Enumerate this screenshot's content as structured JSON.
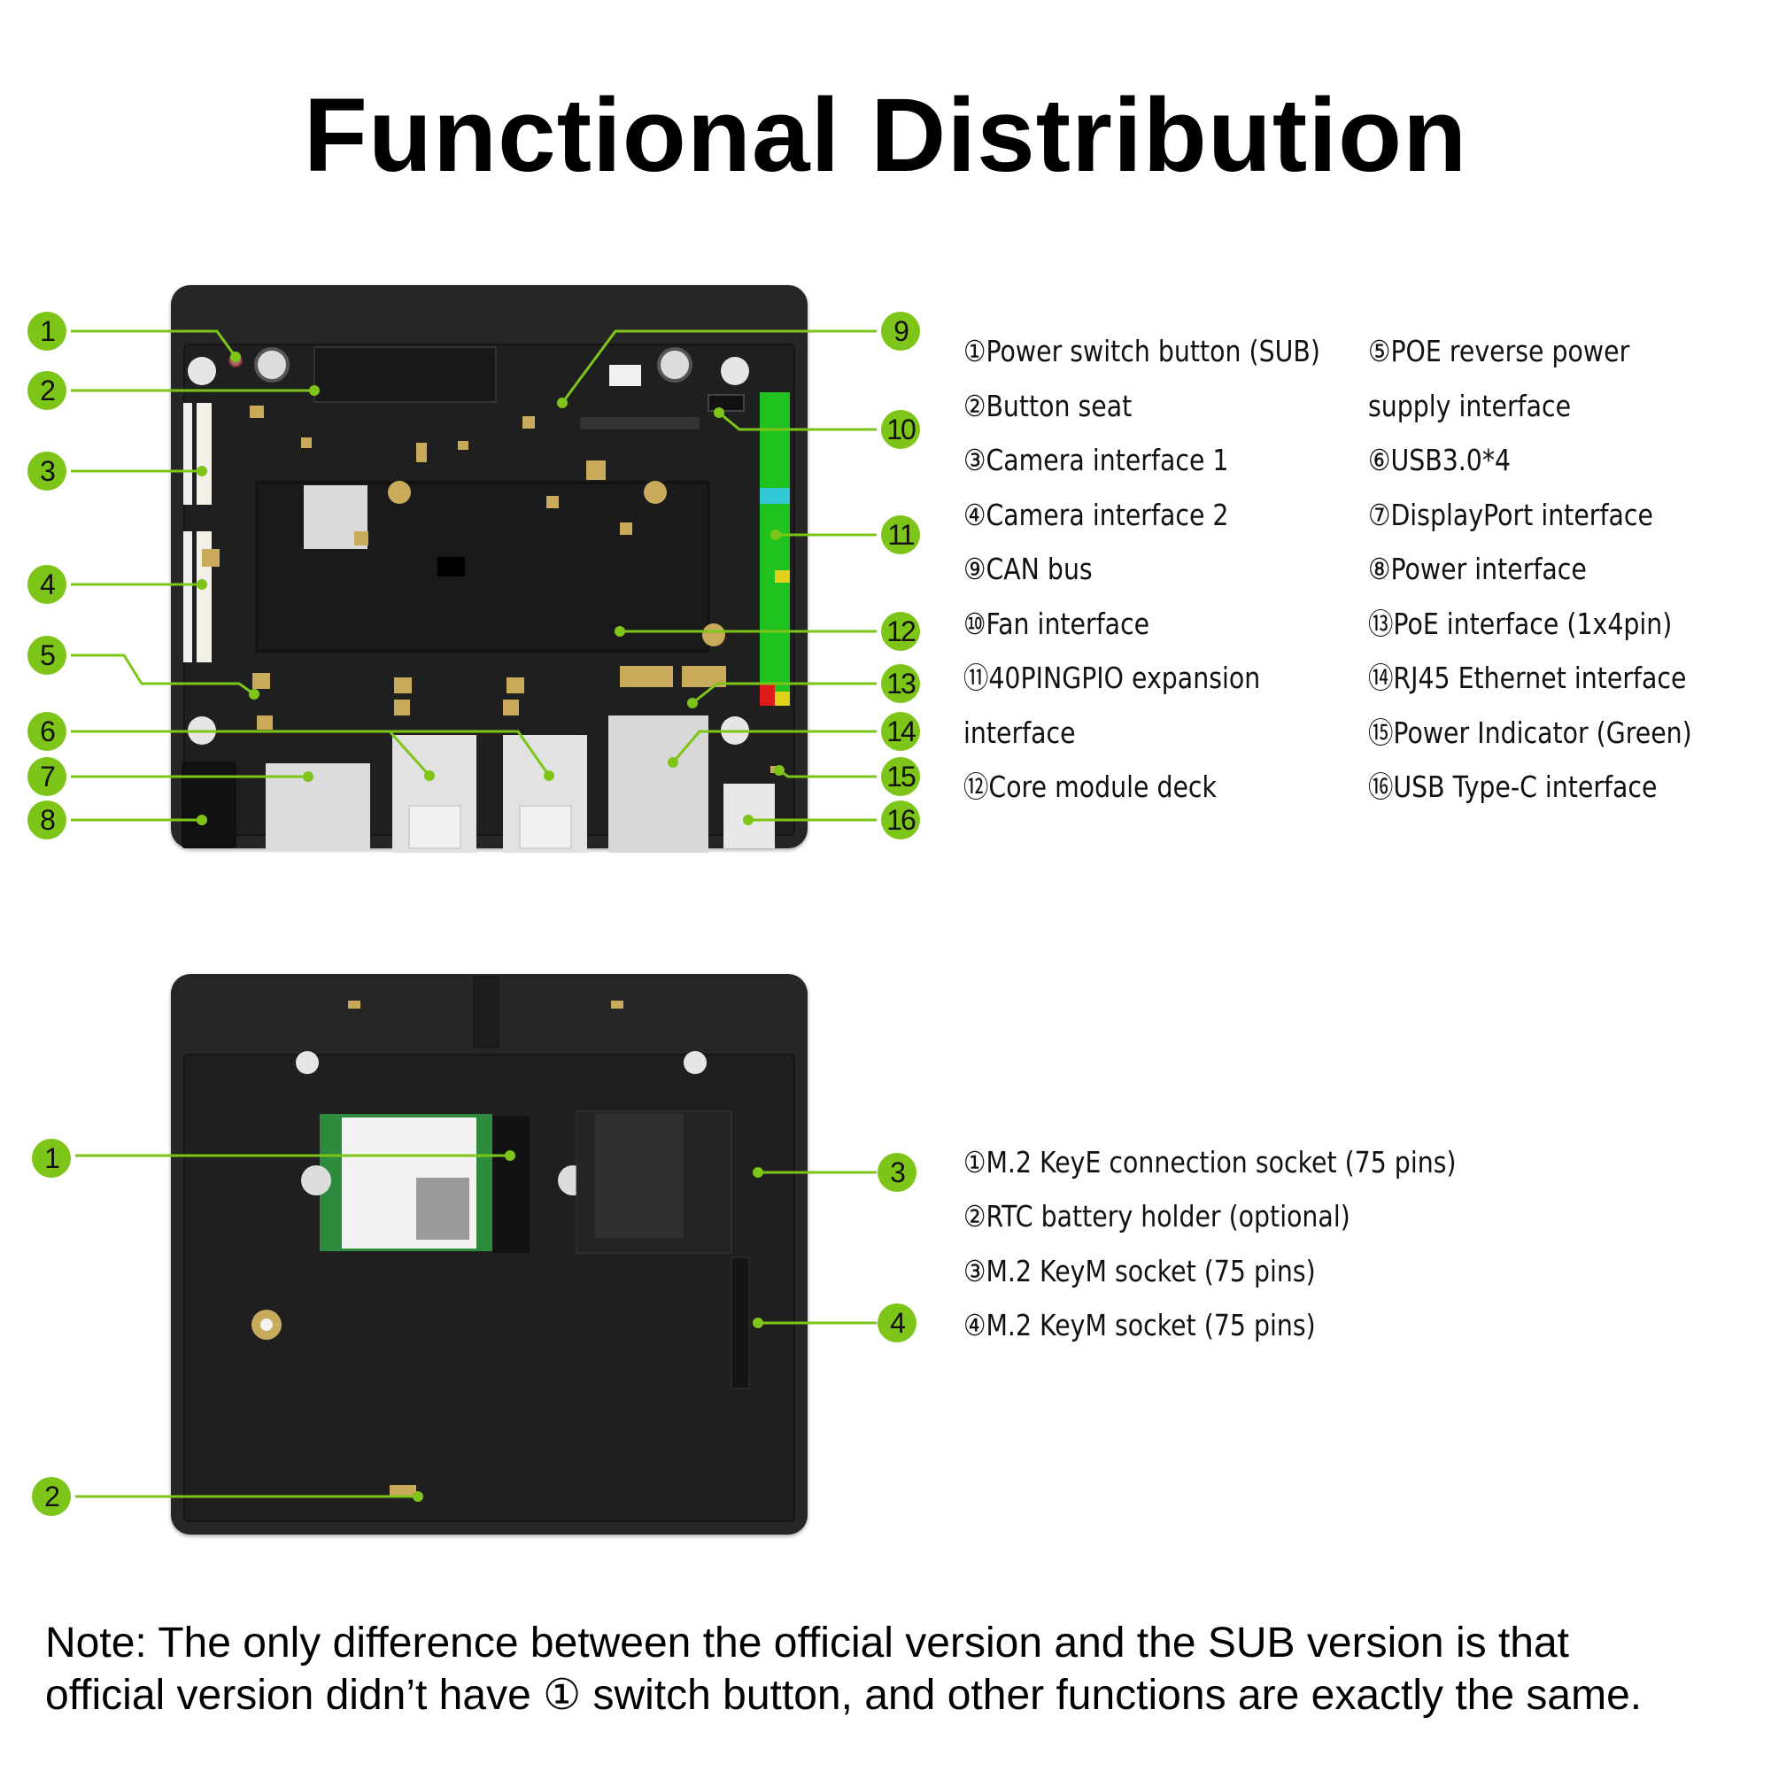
{
  "title": "Functional Distribution",
  "colors": {
    "callout_green": "#7ec51a",
    "board_dark": "#262626",
    "pcb_dark": "#1f1f1f",
    "component_gold": "#c8aa5a",
    "connector_silver": "#d9d9d9",
    "gpio_green": "#1fc21f",
    "gpio_cyan": "#34c8d6",
    "gpio_red": "#e01b1b",
    "gpio_yellow": "#e0d21b"
  },
  "top_view": {
    "callouts_left": [
      "1",
      "2",
      "3",
      "4",
      "5",
      "6",
      "7",
      "8"
    ],
    "callouts_right": [
      "9",
      "10",
      "11",
      "12",
      "13",
      "14",
      "15",
      "16"
    ],
    "legend_col1": [
      "①Power switch button (SUB)",
      "②Button seat",
      "③Camera interface 1",
      "④Camera interface 2",
      "⑨CAN bus",
      "⑩Fan interface",
      "⑪40PINGPIO expansion",
      "interface",
      "⑫Core module deck"
    ],
    "legend_col2": [
      "⑤POE reverse power",
      "supply interface",
      "⑥USB3.0*4",
      "⑦DisplayPort interface",
      "⑧Power interface",
      "⑬PoE interface (1x4pin)",
      "⑭RJ45 Ethernet interface",
      "⑮Power Indicator (Green)",
      "⑯USB Type-C interface"
    ]
  },
  "bottom_view": {
    "callouts": [
      "1",
      "2",
      "3",
      "4"
    ],
    "legend": [
      "①M.2 KeyE connection socket (75 pins)",
      "②RTC battery holder (optional)",
      "③M.2 KeyM socket (75 pins)",
      "④M.2 KeyM socket (75 pins)"
    ]
  },
  "note": {
    "line1": "Note: The only difference between the official version and the SUB version is that",
    "line2": "official version didn’t have ① switch button, and other functions are exactly the same."
  }
}
